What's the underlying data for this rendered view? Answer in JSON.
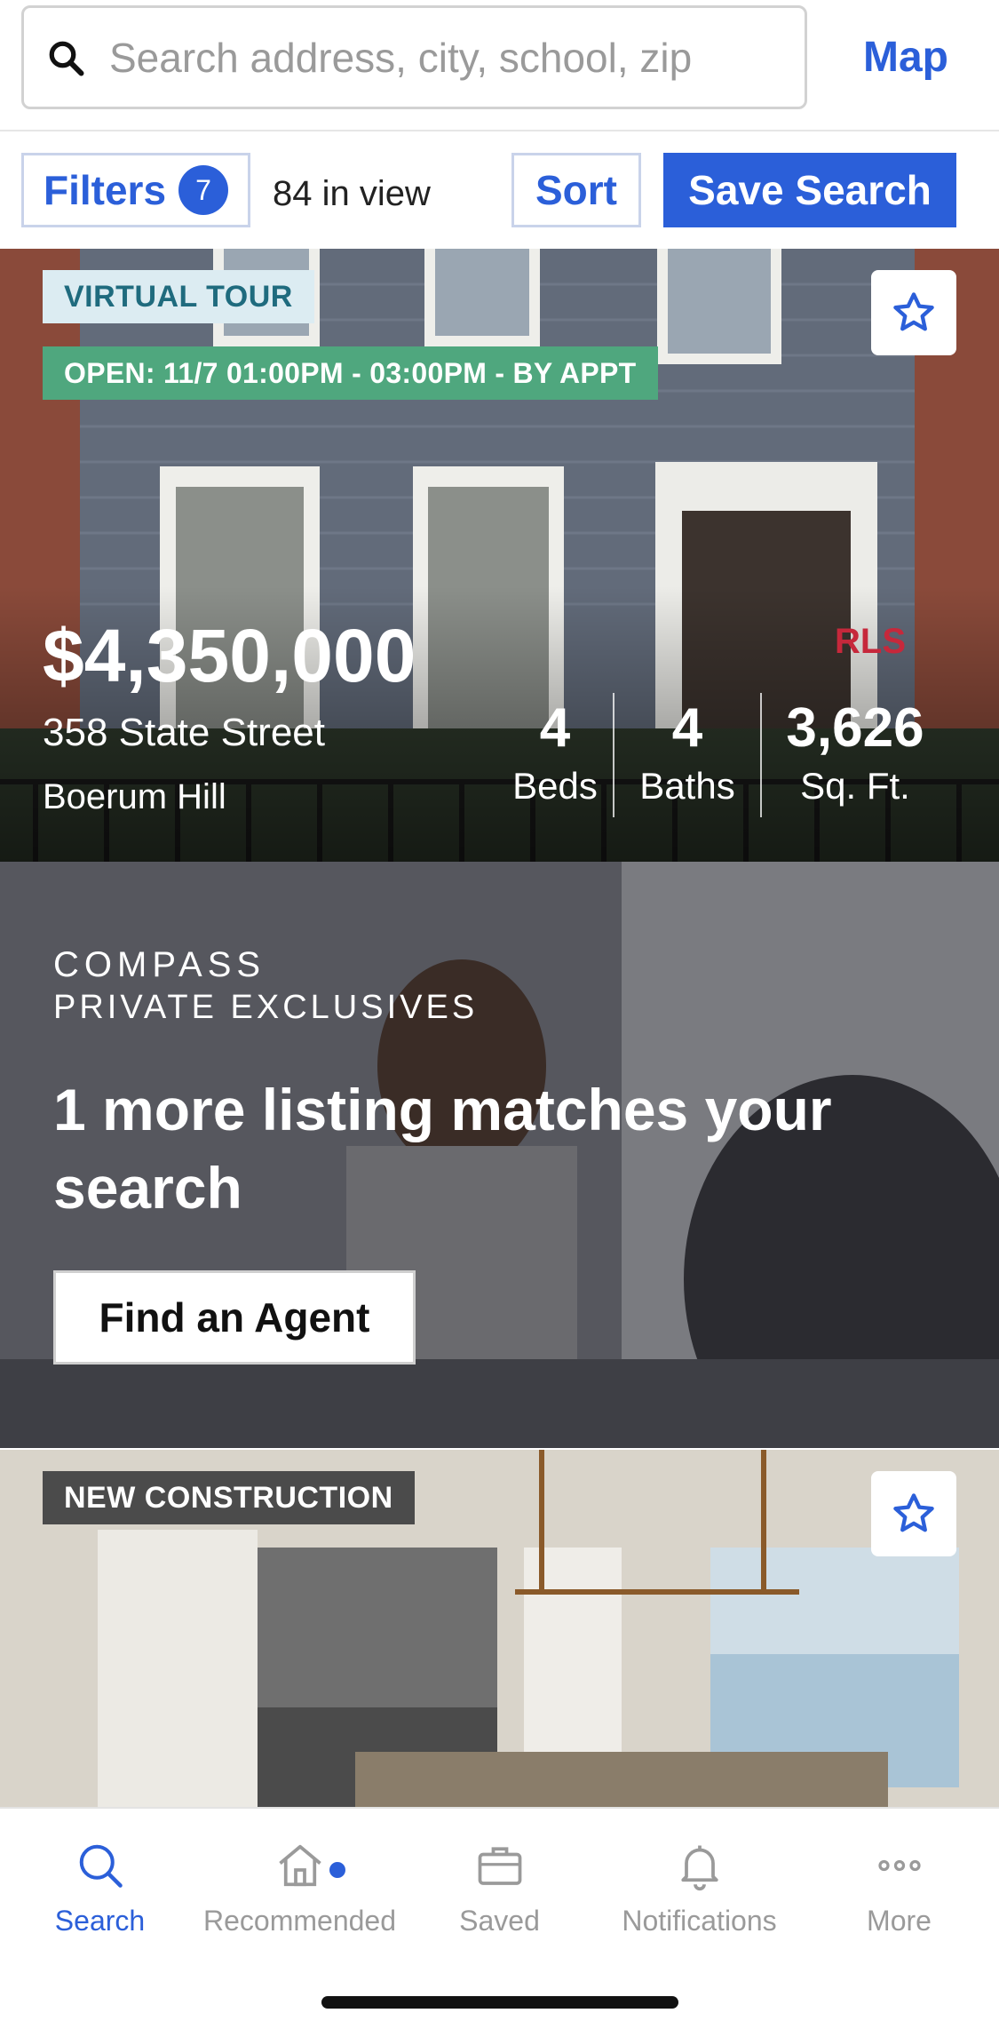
{
  "search": {
    "placeholder": "Search address, city, school, zip",
    "map_label": "Map"
  },
  "toolbar": {
    "filters_label": "Filters",
    "filters_count": "7",
    "in_view": "84 in view",
    "sort_label": "Sort",
    "save_search_label": "Save Search"
  },
  "listings": [
    {
      "badges": [
        "VIRTUAL TOUR",
        "OPEN: 11/7 01:00PM - 03:00PM - BY APPT"
      ],
      "price": "$4,350,000",
      "address": "358 State Street",
      "neighborhood": "Boerum Hill",
      "stats": [
        {
          "value": "4",
          "label": "Beds"
        },
        {
          "value": "4",
          "label": "Baths"
        },
        {
          "value": "3,626",
          "label": "Sq. Ft."
        }
      ],
      "brokerage_logo": "RLS"
    },
    {
      "badges": [
        "NEW CONSTRUCTION"
      ]
    }
  ],
  "promo": {
    "brand": "COMPASS",
    "subtitle": "PRIVATE EXCLUSIVES",
    "heading": "1 more listing matches your search",
    "button_label": "Find an Agent"
  },
  "tabbar": {
    "items": [
      {
        "label": "Search",
        "icon": "search-icon",
        "active": true
      },
      {
        "label": "Recommended",
        "icon": "home-icon",
        "active": false,
        "dot": true
      },
      {
        "label": "Saved",
        "icon": "briefcase-icon",
        "active": false
      },
      {
        "label": "Notifications",
        "icon": "bell-icon",
        "active": false
      },
      {
        "label": "More",
        "icon": "more-icon",
        "active": false
      }
    ]
  },
  "colors": {
    "accent": "#2b5fd9",
    "open_house_badge": "#4fa77e",
    "virtual_tour_badge": "#dcecf2",
    "new_construction_badge": "#4b4b4b"
  }
}
